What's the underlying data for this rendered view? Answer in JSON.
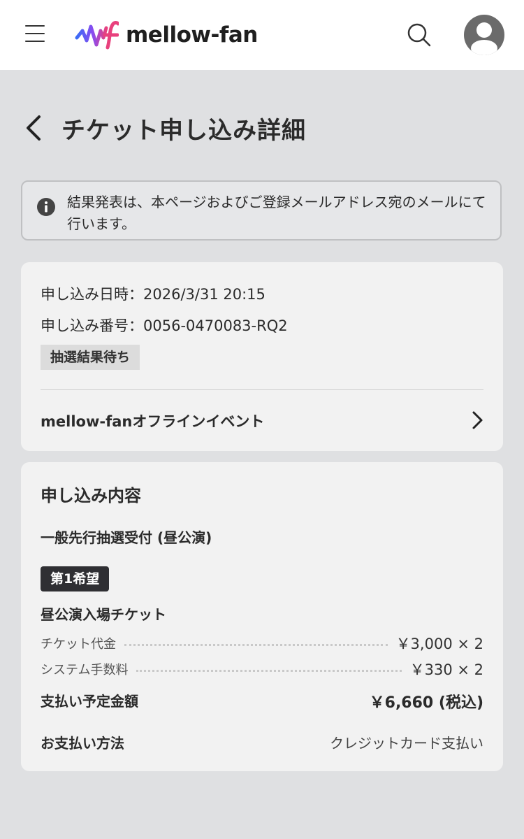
{
  "header": {
    "logo_text": "mellow-fan",
    "logo_colors": {
      "gradient_start": "#3b6cf6",
      "gradient_end": "#e8417d"
    }
  },
  "page": {
    "title": "チケット申し込み詳細"
  },
  "notice": {
    "text": "結果発表は、本ページおよびご登録メールアドレス宛のメールにて行います。"
  },
  "application": {
    "date_text": "申し込み日時：2026/3/31 20:15",
    "number_text": "申し込み番号：0056-0470083-RQ2",
    "status": "抽選結果待ち",
    "event_title": "mellow-fanオフラインイベント"
  },
  "details": {
    "section_title": "申し込み内容",
    "plan_name": "一般先行抽選受付 (昼公演)",
    "choice_badge": "第1希望",
    "ticket_name": "昼公演入場チケット",
    "fees": [
      {
        "label": "チケット代金",
        "value": "￥3,000 × 2"
      },
      {
        "label": "システム手数料",
        "value": "￥330 × 2"
      }
    ],
    "total_label": "支払い予定金額",
    "total_value": "￥6,660 (税込)",
    "payment_label": "お支払い方法",
    "payment_value": "クレジットカード支払い"
  },
  "icons": [
    "menu-icon",
    "search-icon",
    "user-icon",
    "back-icon",
    "info-icon",
    "chevron-right-icon"
  ]
}
